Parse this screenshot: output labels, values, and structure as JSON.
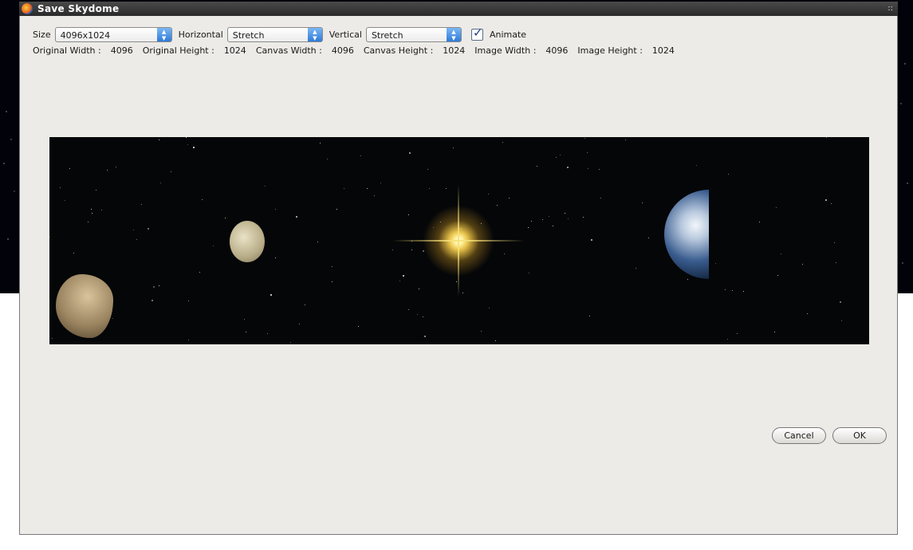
{
  "window": {
    "title": "Save Skydome",
    "grip_icon": "::"
  },
  "controls": {
    "size_label": "Size",
    "size_value": "4096x1024",
    "horizontal_label": "Horizontal",
    "horizontal_value": "Stretch",
    "vertical_label": "Vertical",
    "vertical_value": "Stretch",
    "animate_label": "Animate",
    "animate_checked": true
  },
  "info": [
    {
      "key": "Original Width :",
      "value": "4096"
    },
    {
      "key": "Original Height :",
      "value": "1024"
    },
    {
      "key": "Canvas Width :",
      "value": "4096"
    },
    {
      "key": "Canvas Height :",
      "value": "1024"
    },
    {
      "key": "Image Width :",
      "value": "4096"
    },
    {
      "key": "Image Height :",
      "value": "1024"
    }
  ],
  "buttons": {
    "cancel": "Cancel",
    "ok": "OK"
  },
  "colors": {
    "accent": "#2f7ad8",
    "dialog_bg": "#edebe7",
    "titlebar": "#2a2a2a"
  }
}
